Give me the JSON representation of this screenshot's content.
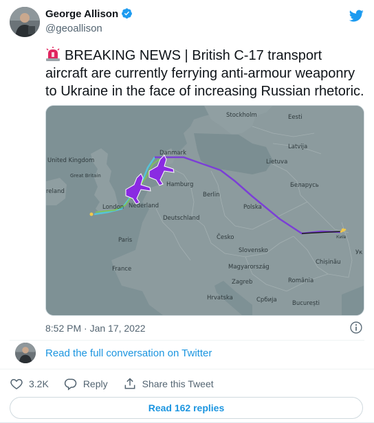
{
  "author": {
    "name": "George Allison",
    "handle": "@geoallison",
    "verified": true
  },
  "tweet": {
    "emoji": "🚨",
    "text": "BREAKING NEWS | British C-17 transport aircraft are currently ferrying anti-armour weaponry to Ukraine in the face of increasing Russian rhetoric.",
    "timestamp": "8:52 PM · Jan 17, 2022"
  },
  "map": {
    "labels": {
      "stockholm": "Stockholm",
      "eesti": "Eesti",
      "united_kingdom": "United Kingdom",
      "danmark": "Danmark",
      "latvija": "Latvija",
      "lietuva": "Lietuva",
      "great_britain": "Great Britain",
      "hamburg": "Hamburg",
      "belarus": "Беларусь",
      "ireland": "reland",
      "berlin": "Berlin",
      "nederland": "Nederland",
      "london": "London",
      "polska": "Polska",
      "deutschland": "Deutschland",
      "paris": "Paris",
      "cesko": "Česko",
      "kyiv": "Київ",
      "slovensko": "Slovensko",
      "chisinau": "Chișinău",
      "france": "France",
      "magyarorszag": "Magyarország",
      "uk_partial": "Ук",
      "zagreb": "Zagreb",
      "romania": "România",
      "hrvatska": "Hrvatska",
      "srbija": "Србија",
      "bucuresti": "București"
    },
    "flight_color": "#7b3fd6",
    "aircraft_color": "#8a2be2"
  },
  "thread": {
    "link_text": "Read the full conversation on Twitter"
  },
  "actions": {
    "likes": "3.2K",
    "reply_label": "Reply",
    "share_label": "Share this Tweet"
  },
  "replies_button": "Read 162 replies",
  "colors": {
    "link": "#1b95e0",
    "secondary_text": "#536471",
    "twitter_blue": "#1d9bf0"
  }
}
